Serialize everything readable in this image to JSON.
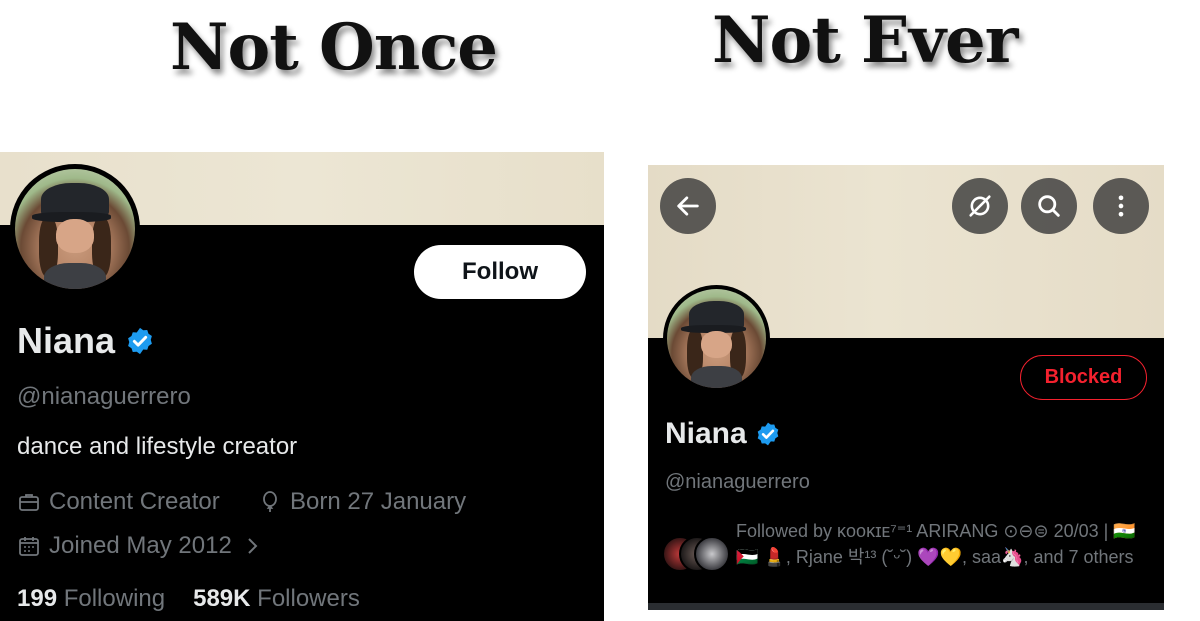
{
  "headings": {
    "left": "Not Once",
    "right": "Not Ever"
  },
  "left": {
    "follow_label": "Follow",
    "name": "Niana",
    "handle": "@nianaguerrero",
    "bio": "dance and lifestyle creator",
    "work": "Content Creator",
    "born": "Born 27 January",
    "joined": "Joined May 2012",
    "following_count": "199",
    "following_label": "Following",
    "followers_count": "589K",
    "followers_label": "Followers"
  },
  "right": {
    "blocked_label": "Blocked",
    "name": "Niana",
    "handle": "@nianaguerrero",
    "followed_by": "Followed by ᴋᴏᴏᴋɪᴇ⁷⁼¹ ARIRANG ⊙⊖⊜ 20/03 | 🇮🇳 🇵🇸 💄, Rjane 박¹³ (˘ᵕ˘) 💜💛, saa🦄, and 7 others"
  },
  "colors": {
    "verified": "#1d9bf0",
    "blocked": "#f4212e",
    "muted_text": "#71767b",
    "primary_text": "#e7e9ea",
    "background": "#000000"
  },
  "icons": {
    "back": "arrow-left-icon",
    "grok": "grok-icon",
    "search": "search-icon",
    "more": "more-vertical-icon",
    "work": "briefcase-icon",
    "born": "balloon-icon",
    "joined": "calendar-icon",
    "joined_chevron": "chevron-right-icon",
    "verified": "verified-badge-icon"
  }
}
